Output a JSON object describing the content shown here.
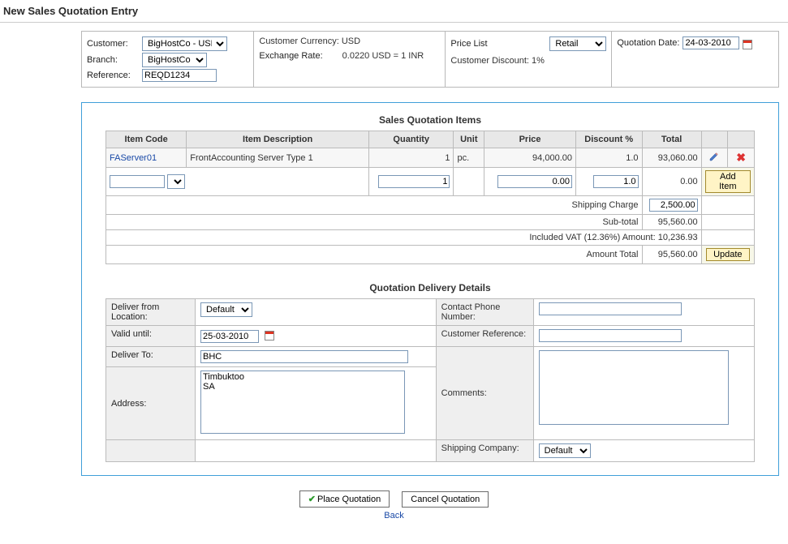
{
  "pageTitle": "New Sales Quotation Entry",
  "header": {
    "customerLabel": "Customer:",
    "customer": "BigHostCo - USD",
    "branchLabel": "Branch:",
    "branch": "BigHostCo",
    "referenceLabel": "Reference:",
    "reference": "REQD1234",
    "currencyLabel": "Customer Currency: USD",
    "exchangeLabel": "Exchange Rate:",
    "exchangeValue": "0.0220 USD = 1 INR",
    "priceListLabel": "Price List",
    "priceList": "Retail",
    "discountLabel": "Customer Discount: 1%",
    "quoteDateLabel": "Quotation Date:",
    "quoteDate": "24-03-2010"
  },
  "items": {
    "title": "Sales Quotation Items",
    "columns": {
      "code": "Item Code",
      "desc": "Item Description",
      "qty": "Quantity",
      "unit": "Unit",
      "price": "Price",
      "disc": "Discount %",
      "total": "Total"
    },
    "row": {
      "code": "FAServer01",
      "desc": "FrontAccounting Server Type 1",
      "qty": "1",
      "unit": "pc.",
      "price": "94,000.00",
      "disc": "1.0",
      "total": "93,060.00"
    },
    "newrow": {
      "qty": "1",
      "price": "0.00",
      "disc": "1.0",
      "total": "0.00",
      "addBtn": "Add Item"
    },
    "shippingLabel": "Shipping Charge",
    "shipping": "2,500.00",
    "subtotalLabel": "Sub-total",
    "subtotal": "95,560.00",
    "vatLabel": "Included VAT (12.36%) Amount: 10,236.93",
    "amountTotalLabel": "Amount Total",
    "amountTotal": "95,560.00",
    "updateBtn": "Update"
  },
  "delivery": {
    "title": "Quotation Delivery Details",
    "fromLabel": "Deliver from Location:",
    "from": "Default",
    "validLabel": "Valid until:",
    "valid": "25-03-2010",
    "deliverToLabel": "Deliver To:",
    "deliverTo": "BHC",
    "addressLabel": "Address:",
    "address": "Timbuktoo\nSA",
    "phoneLabel": "Contact Phone Number:",
    "phone": "",
    "crefLabel": "Customer Reference:",
    "cref": "",
    "commentsLabel": "Comments:",
    "comments": "",
    "shipcoLabel": "Shipping Company:",
    "shipco": "Default"
  },
  "footer": {
    "place": "Place Quotation",
    "cancel": "Cancel Quotation",
    "back": "Back"
  }
}
